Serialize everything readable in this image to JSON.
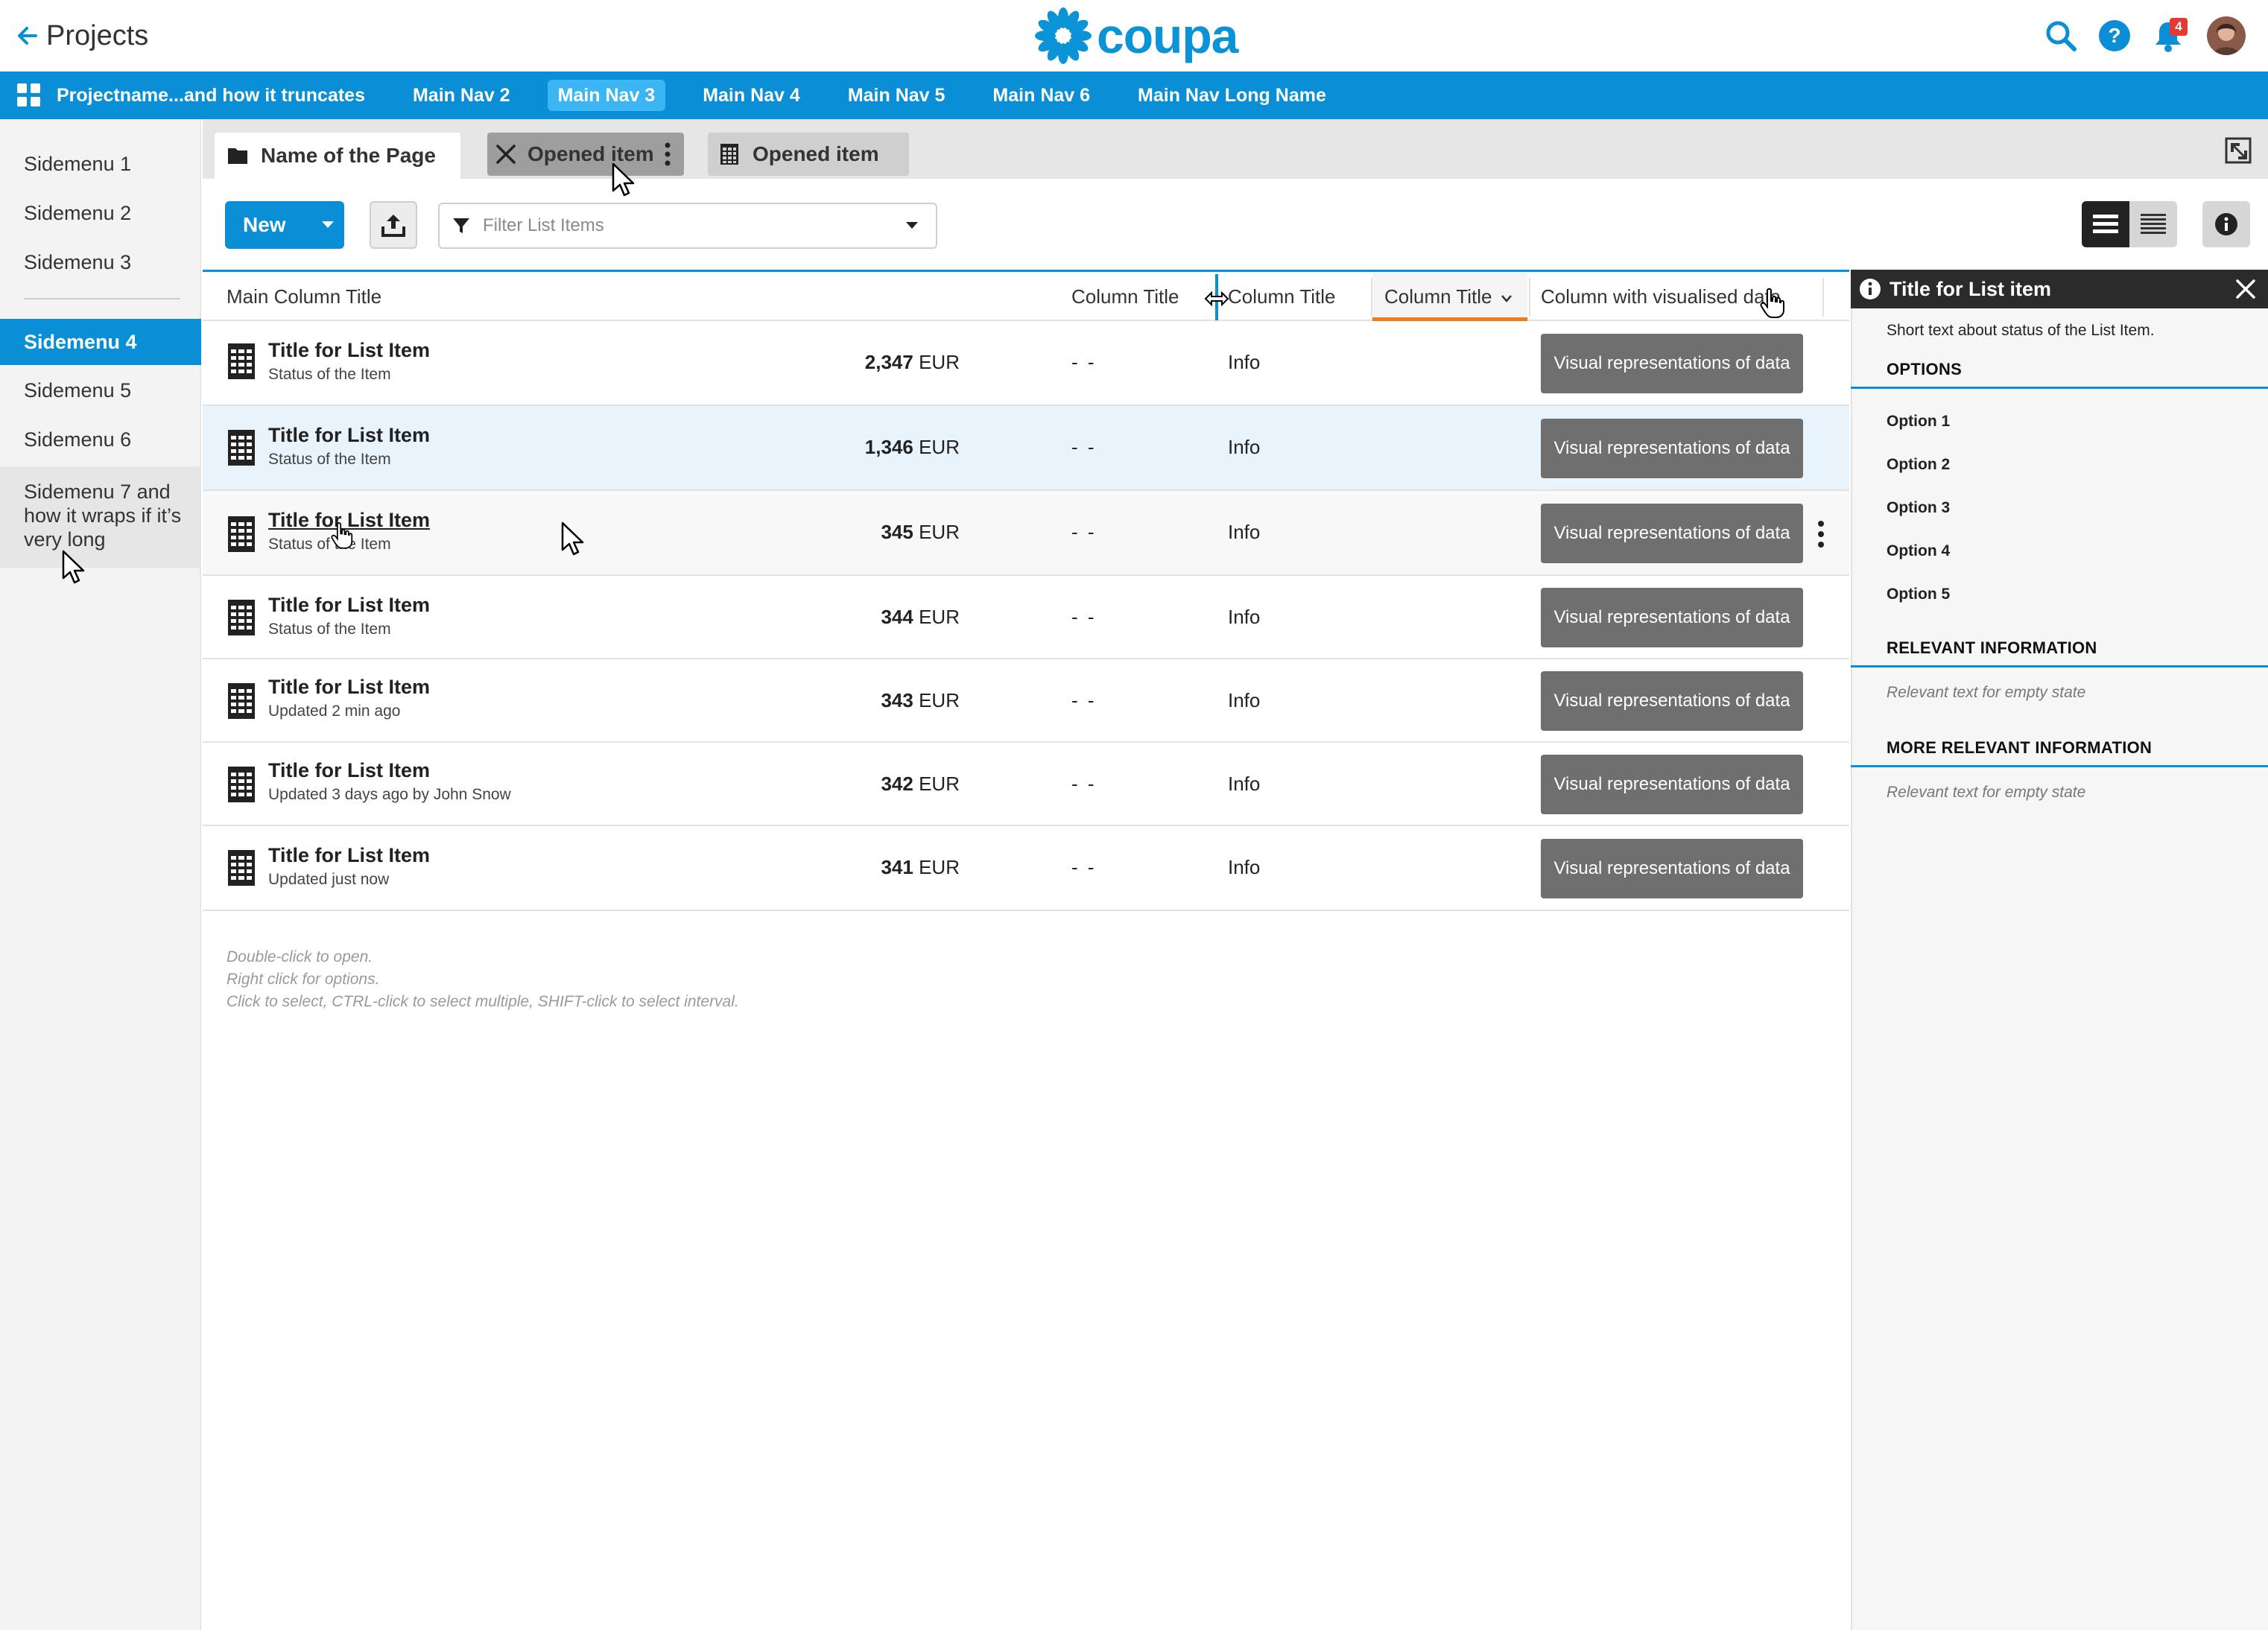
{
  "header": {
    "title": "Projects",
    "logo_text": "coupa",
    "notification_count": "4",
    "brand_color": "#0a8fd6"
  },
  "mainnav": {
    "items": [
      {
        "label": "Projectname...and how it truncates"
      },
      {
        "label": "Main Nav 2"
      },
      {
        "label": "Main Nav 3",
        "active": true
      },
      {
        "label": "Main Nav 4"
      },
      {
        "label": "Main Nav 5"
      },
      {
        "label": "Main Nav 6"
      },
      {
        "label": "Main Nav Long Name"
      }
    ]
  },
  "sidebar": {
    "items": [
      {
        "label": "Sidemenu 1"
      },
      {
        "label": "Sidemenu 2"
      },
      {
        "label": "Sidemenu 3"
      },
      {
        "label": "Sidemenu 4",
        "active": true
      },
      {
        "label": "Sidemenu 5"
      },
      {
        "label": "Sidemenu 6"
      },
      {
        "label": "Sidemenu 7 and how it wraps if it’s very long"
      }
    ]
  },
  "tabs": [
    {
      "label": "Name of the Page",
      "icon": "folder-icon"
    },
    {
      "label": "Opened item",
      "icon": "close-icon"
    },
    {
      "label": "Opened item",
      "icon": "document-grid-icon"
    }
  ],
  "toolbar": {
    "new_label": "New",
    "filter_placeholder": "Filter List Items"
  },
  "table": {
    "columns": [
      "Main Column Title",
      "Column Title",
      "Column Title",
      "Column Title",
      "Column with visualised data"
    ],
    "rows": [
      {
        "title": "Title for List Item",
        "status": "Status of the Item",
        "col2": "- -",
        "col3": "Info",
        "amount": "2,347",
        "currency": "EUR",
        "viz": "Visual representations of data"
      },
      {
        "title": "Title for List Item",
        "status": "Status of the Item",
        "col2": "- -",
        "col3": "Info",
        "amount": "1,346",
        "currency": "EUR",
        "viz": "Visual representations of data"
      },
      {
        "title": "Title for List Item",
        "status": "Status of the Item",
        "col2": "- -",
        "col3": "Info",
        "amount": "345",
        "currency": "EUR",
        "viz": "Visual representations of data"
      },
      {
        "title": "Title for List Item",
        "status": "Status of the Item",
        "col2": "- -",
        "col3": "Info",
        "amount": "344",
        "currency": "EUR",
        "viz": "Visual representations of data"
      },
      {
        "title": "Title for List Item",
        "status": "Updated 2 min ago",
        "col2": "- -",
        "col3": "Info",
        "amount": "343",
        "currency": "EUR",
        "viz": "Visual representations of data"
      },
      {
        "title": "Title for List Item",
        "status": "Updated 3 days ago by John Snow",
        "col2": "- -",
        "col3": "Info",
        "amount": "342",
        "currency": "EUR",
        "viz": "Visual representations of data"
      },
      {
        "title": "Title for List Item",
        "status": "Updated just now",
        "col2": "- -",
        "col3": "Info",
        "amount": "341",
        "currency": "EUR",
        "viz": "Visual representations of data"
      }
    ],
    "hints": [
      "Double-click to open.",
      "Right click for options.",
      "Click to select, CTRL-click to select multiple, SHIFT-click to select interval."
    ]
  },
  "panel": {
    "title": "Title for List item",
    "summary": "Short text about status of the List Item.",
    "options_heading": "OPTIONS",
    "options": [
      "Option 1",
      "Option 2",
      "Option 3",
      "Option 4",
      "Option 5"
    ],
    "relevant_heading": "RELEVANT INFORMATION",
    "relevant_empty": "Relevant text for empty state",
    "more_heading": "MORE RELEVANT INFORMATION",
    "more_empty": "Relevant text for empty state"
  }
}
